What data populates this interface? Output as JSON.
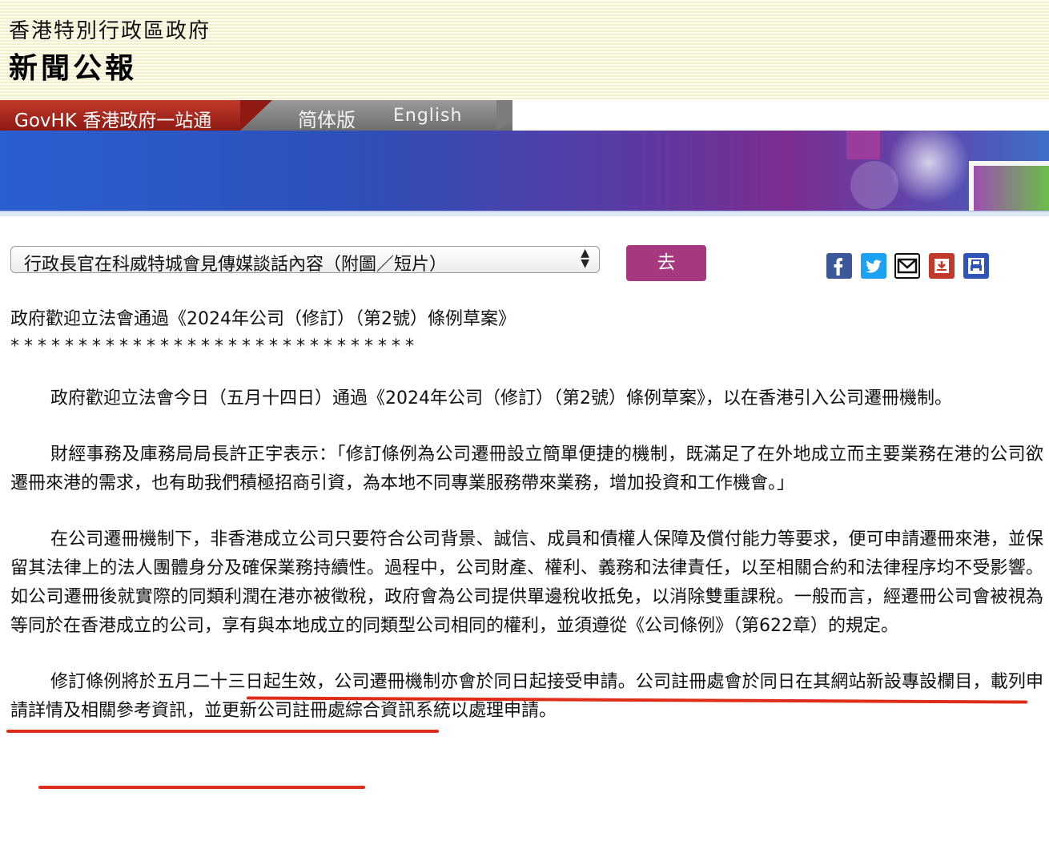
{
  "header": {
    "gov_title": "香港特別行政區政府",
    "press_title": "新聞公報"
  },
  "nav": {
    "govhk": "GovHK 香港政府一站通",
    "simplified": "简体版",
    "english": "English"
  },
  "toolbar": {
    "select_value": "行政長官在科威特城會見傳媒談話內容（附圖／短片）",
    "go_label": "去",
    "share_icons": [
      "facebook-icon",
      "twitter-icon",
      "email-icon",
      "save-icon",
      "print-icon"
    ]
  },
  "article": {
    "title": "政府歡迎立法會通過《2024年公司（修訂）（第2號）條例草案》",
    "stars": "******************************",
    "p1": "政府歡迎立法會今日（五月十四日）通過《2024年公司（修訂）（第2號）條例草案》，以在香港引入公司遷冊機制。",
    "p2": "財經事務及庫務局局長許正宇表示：「修訂條例為公司遷冊設立簡單便捷的機制，既滿足了在外地成立而主要業務在港的公司欲遷冊來港的需求，也有助我們積極招商引資，為本地不同專業服務帶來業務，增加投資和工作機會。」",
    "p3": "在公司遷冊機制下，非香港成立公司只要符合公司背景、誠信、成員和債權人保障及償付能力等要求，便可申請遷冊來港，並保留其法律上的法人團體身分及確保業務持續性。過程中，公司財產、權利、義務和法律責任，以至相關合約和法律程序均不受影響。如公司遷冊後就實際的同類利潤在港亦被徵稅，政府會為公司提供單邊稅收抵免，以消除雙重課稅。一般而言，經遷冊公司會被視為等同於在香港成立的公司，享有與本地成立的同類型公司相同的權利，並須遵從《公司條例》（第622章）的規定。",
    "p4": "修訂條例將於五月二十三日起生效，公司遷冊機制亦會於同日起接受申請。公司註冊處會於同日在其網站新設專設欄目，載列申請詳情及相關參考資訊，並更新公司註冊處綜合資訊系統以處理申請。"
  },
  "colors": {
    "govhk_red": "#c0392b",
    "go_button": "#a6387f",
    "underline": "#e02d1a"
  }
}
